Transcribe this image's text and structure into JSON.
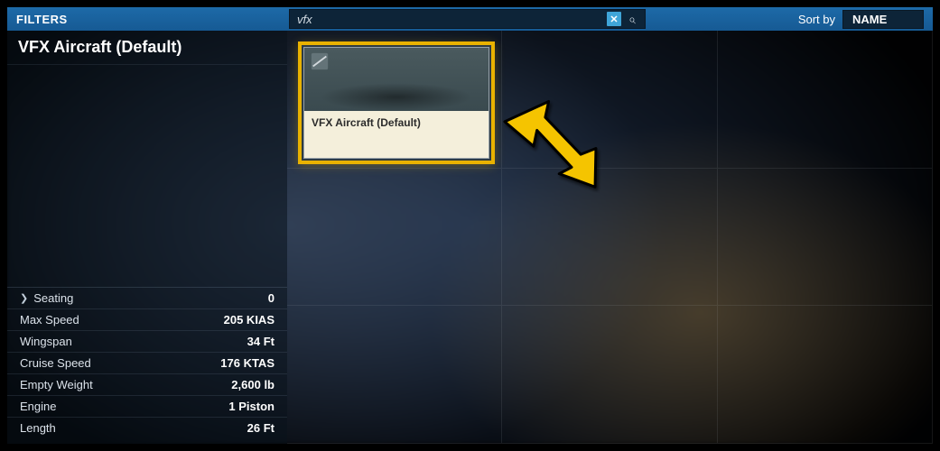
{
  "topbar": {
    "filters_label": "FILTERS",
    "search_value": "vfx",
    "clear_glyph": "✕",
    "search_glyph": "⌕",
    "sortby_label": "Sort by",
    "sortby_value": "NAME"
  },
  "sidebar": {
    "title": "VFX Aircraft (Default)",
    "stats": [
      {
        "label": "Seating",
        "value": "0",
        "expandable": true
      },
      {
        "label": "Max Speed",
        "value": "205 KIAS",
        "expandable": false
      },
      {
        "label": "Wingspan",
        "value": "34 Ft",
        "expandable": false
      },
      {
        "label": "Cruise Speed",
        "value": "176 KTAS",
        "expandable": false
      },
      {
        "label": "Empty Weight",
        "value": "2,600 lb",
        "expandable": false
      },
      {
        "label": "Engine",
        "value": "1 Piston",
        "expandable": false
      },
      {
        "label": "Length",
        "value": "26 Ft",
        "expandable": false
      }
    ]
  },
  "card": {
    "title": "VFX Aircraft (Default)",
    "logo_name": "cessna-logo"
  },
  "colors": {
    "accent": "#e9b200",
    "header": "#1d6aa8"
  }
}
